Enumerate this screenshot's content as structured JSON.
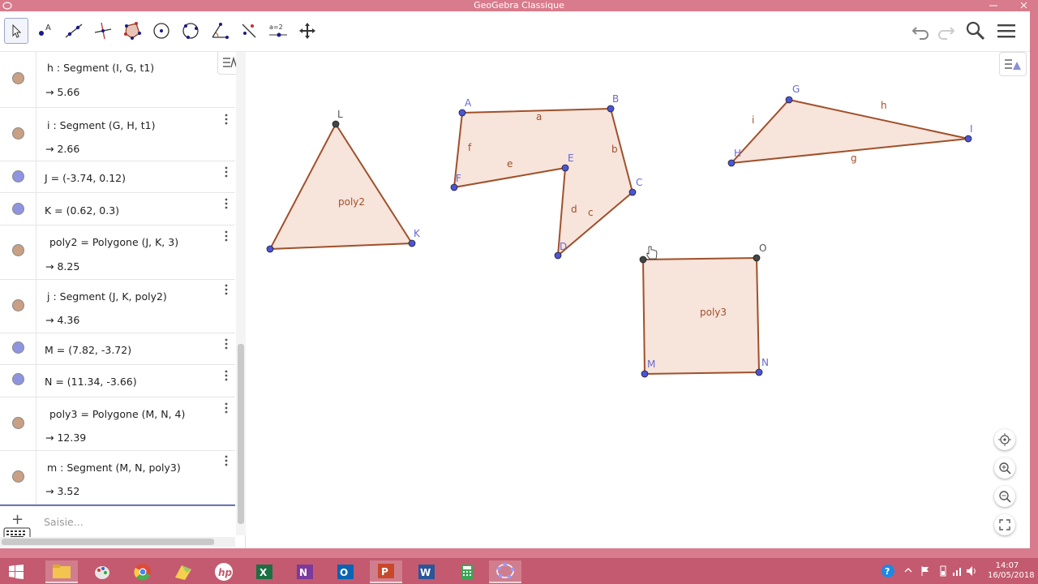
{
  "window": {
    "title": "GeoGebra Classique"
  },
  "toolbar": {
    "tools": [
      {
        "name": "move-tool"
      },
      {
        "name": "point-tool",
        "label": "A"
      },
      {
        "name": "line-tool"
      },
      {
        "name": "perpendicular-tool"
      },
      {
        "name": "polygon-tool"
      },
      {
        "name": "circle-tool"
      },
      {
        "name": "conic-tool"
      },
      {
        "name": "angle-tool"
      },
      {
        "name": "reflect-tool"
      },
      {
        "name": "slider-tool",
        "label": "a=2"
      },
      {
        "name": "move-view-tool"
      }
    ]
  },
  "algebra": {
    "rows": [
      {
        "def": "h : Segment (I, G, t1)",
        "val": "→  5.66",
        "color": "#c9a083"
      },
      {
        "def": "i : Segment (G, H, t1)",
        "val": "→  2.66",
        "color": "#c9a083"
      },
      {
        "def": "J = (-3.74, 0.12)",
        "val": "",
        "color": "#8f94e0"
      },
      {
        "def": "K = (0.62, 0.3)",
        "val": "",
        "color": "#8f94e0"
      },
      {
        "def": "poly2 = Polygone (J, K, 3)",
        "val": "→  8.25",
        "color": "#c9a083"
      },
      {
        "def": "j : Segment (J, K, poly2)",
        "val": "→  4.36",
        "color": "#c9a083"
      },
      {
        "def": "M = (7.82, -3.72)",
        "val": "",
        "color": "#8f94e0"
      },
      {
        "def": "N = (11.34, -3.66)",
        "val": "",
        "color": "#8f94e0"
      },
      {
        "def": "poly3 = Polygone (M, N, 4)",
        "val": "→  12.39",
        "color": "#c9a083"
      },
      {
        "def": "m : Segment (M, N, poly3)",
        "val": "→  3.52",
        "color": "#c9a083"
      }
    ],
    "input_placeholder": "Saisie..."
  },
  "graphics": {
    "labels": {
      "L": "L",
      "K": "K",
      "poly2": "poly2",
      "A": "A",
      "B": "B",
      "C": "C",
      "D": "D",
      "E": "E",
      "F": "F",
      "a": "a",
      "b": "b",
      "c": "c",
      "d": "d",
      "e": "e",
      "f": "f",
      "G": "G",
      "H": "H",
      "I": "I",
      "g": "g",
      "h": "h",
      "i": "i",
      "M": "M",
      "N": "N",
      "O": "O",
      "poly3": "poly3"
    }
  },
  "taskbar": {
    "time": "14:07",
    "date": "16/05/2018",
    "apps": [
      "windows-start",
      "file-explorer",
      "paint",
      "chrome",
      "maps",
      "hp",
      "excel",
      "onenote",
      "outlook",
      "powerpoint",
      "word",
      "calculator",
      "geogebra"
    ]
  },
  "colors": {
    "titlebar": "#d87b8c",
    "taskbar": "#c35a6f",
    "polygon_fill": "#f5e1d8",
    "polygon_stroke": "#a0502a",
    "free_point": "#4a54d8",
    "label_point": "#6a6ad0",
    "label_segment": "#a0502a"
  }
}
